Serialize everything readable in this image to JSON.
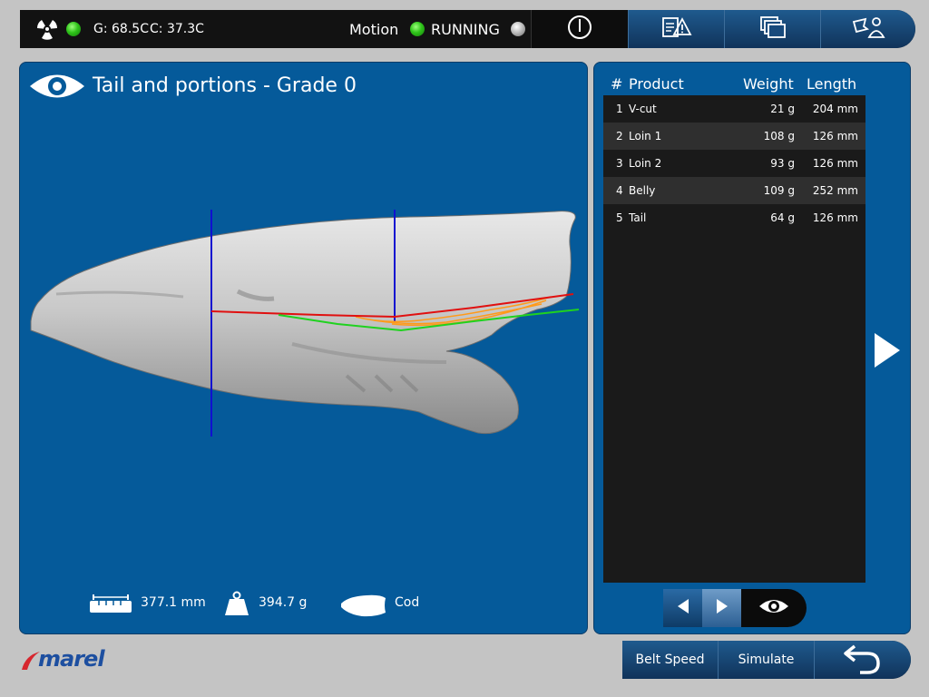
{
  "status": {
    "generator_temp": "G: 68.5C",
    "camera_temp": "C: 37.3C",
    "motion_label": "Motion",
    "motion_state": "RUNNING"
  },
  "toolbar": {
    "buttons": [
      {
        "name": "power-icon"
      },
      {
        "name": "warning-log-icon"
      },
      {
        "name": "documents-icon"
      },
      {
        "name": "operator-icon"
      }
    ]
  },
  "view": {
    "title": "Tail and portions - Grade 0",
    "length": "377.1 mm",
    "weight": "394.7 g",
    "species": "Cod"
  },
  "table": {
    "headers": {
      "num": "#",
      "product": "Product",
      "weight": "Weight",
      "length": "Length"
    },
    "rows": [
      {
        "num": "1",
        "product": "V-cut",
        "weight": "21 g",
        "length": "204 mm"
      },
      {
        "num": "2",
        "product": "Loin 1",
        "weight": "108 g",
        "length": "126 mm"
      },
      {
        "num": "3",
        "product": "Loin 2",
        "weight": "93 g",
        "length": "126 mm"
      },
      {
        "num": "4",
        "product": "Belly",
        "weight": "109 g",
        "length": "252 mm"
      },
      {
        "num": "5",
        "product": "Tail",
        "weight": "64 g",
        "length": "126 mm"
      }
    ]
  },
  "bottom": {
    "belt_speed_label": "Belt Speed",
    "simulate_label": "Simulate"
  },
  "logo_text": "marel",
  "colors": {
    "panel_blue": "#055a9a",
    "status_green": "#2fc41a",
    "cut_red": "#e01010",
    "cut_green": "#1fd21f",
    "cut_orange": "#ff9a1a",
    "line_blue": "#1010d0"
  }
}
